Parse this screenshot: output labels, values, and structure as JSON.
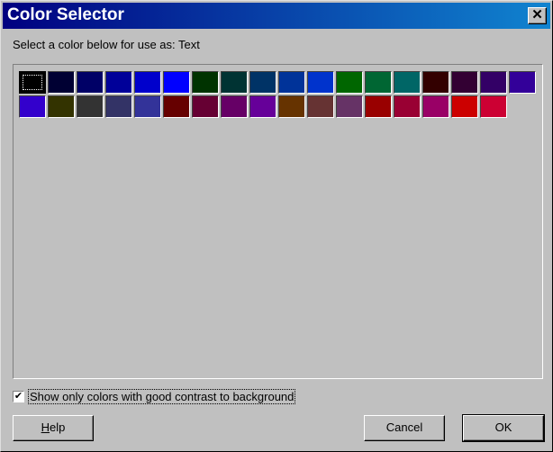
{
  "window": {
    "title": "Color Selector",
    "close_glyph": "✕",
    "close_icon": "close-icon"
  },
  "prompt": "Select a color below for use as: Text",
  "palette": {
    "selected_index": 0,
    "rows": [
      [
        "#000000",
        "#000033",
        "#000066",
        "#000099",
        "#0000cc",
        "#0000ff",
        "#003300",
        "#003333",
        "#003366",
        "#003399",
        "#0033cc",
        "#006600",
        "#006633",
        "#006666",
        "#330000",
        "#330033",
        "#330066",
        "#330099"
      ],
      [
        "#3300cc",
        "#333300",
        "#333333",
        "#333366",
        "#333399",
        "#660000",
        "#660033",
        "#660066",
        "#660099",
        "#663300",
        "#663333",
        "#663366",
        "#990000",
        "#990033",
        "#990066",
        "#cc0000",
        "#cc0033"
      ]
    ]
  },
  "contrast_option": {
    "label": "Show only colors with good contrast to background",
    "checked": true,
    "check_glyph": "✔"
  },
  "buttons": {
    "help": {
      "accel": "H",
      "rest": "elp"
    },
    "cancel": "Cancel",
    "ok": "OK"
  }
}
